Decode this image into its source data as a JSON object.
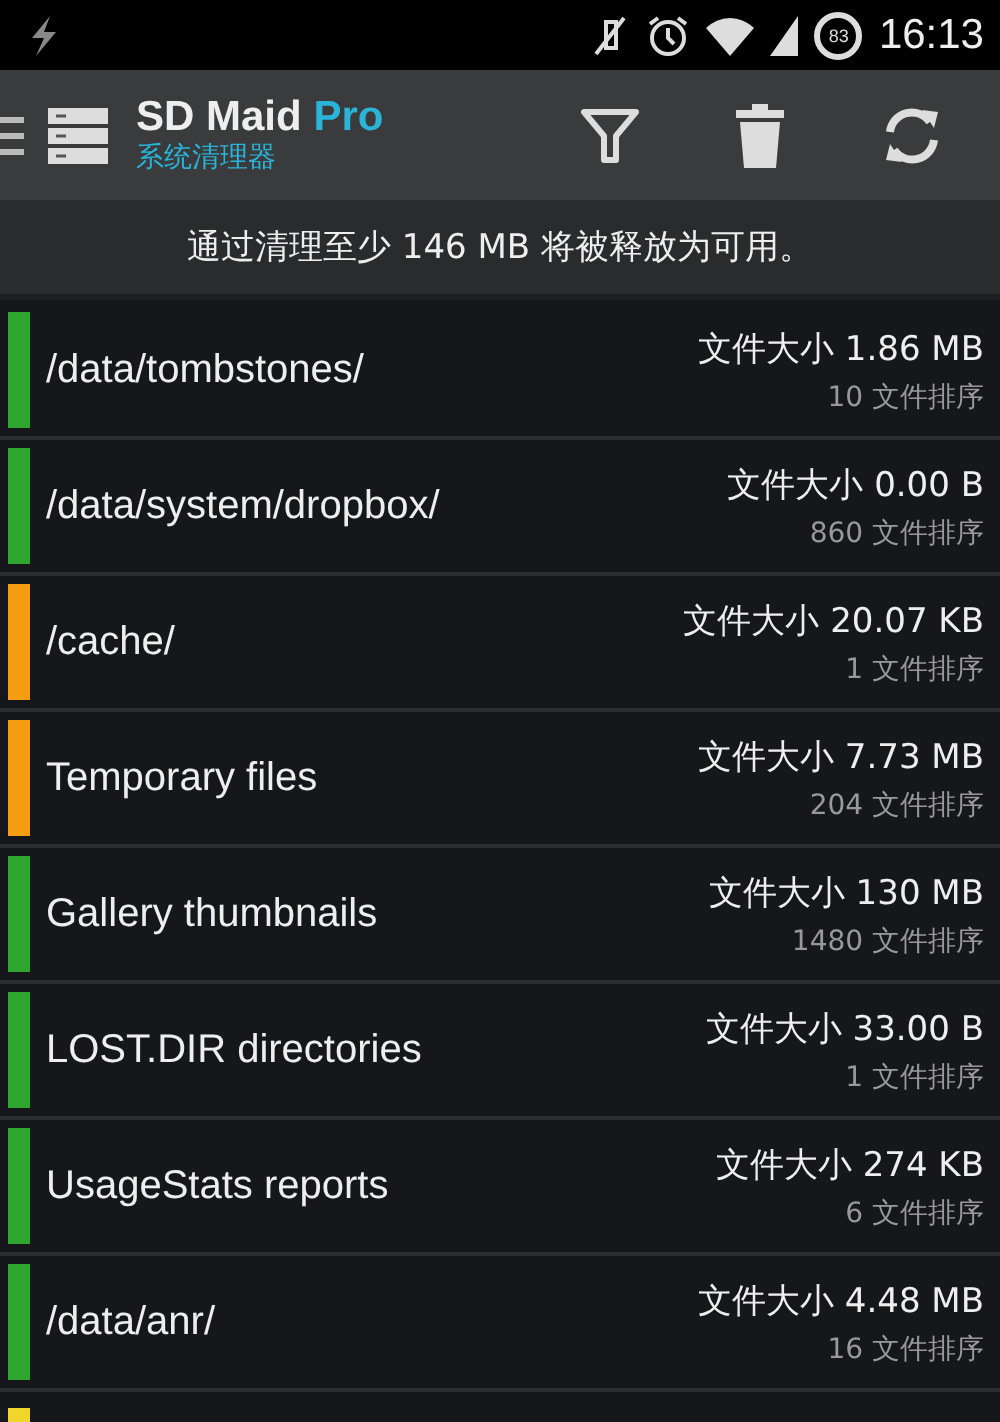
{
  "status_bar": {
    "battery": "83",
    "time": "16:13"
  },
  "toolbar": {
    "title": "SD Maid",
    "title_accent": "Pro",
    "subtitle": "系统清理器"
  },
  "banner": "通过清理至少 146 MB 将被释放为可用。",
  "rows": [
    {
      "name": "/data/tombstones/",
      "size": "文件大小 1.86 MB",
      "count": "10 文件排序",
      "color": "#2ea52e"
    },
    {
      "name": "/data/system/dropbox/",
      "size": "文件大小 0.00 B",
      "count": "860 文件排序",
      "color": "#2ea52e"
    },
    {
      "name": "/cache/",
      "size": "文件大小 20.07 KB",
      "count": "1 文件排序",
      "color": "#f59c10"
    },
    {
      "name": "Temporary files",
      "size": "文件大小 7.73 MB",
      "count": "204 文件排序",
      "color": "#f59c10"
    },
    {
      "name": "Gallery thumbnails",
      "size": "文件大小 130 MB",
      "count": "1480 文件排序",
      "color": "#2ea52e"
    },
    {
      "name": "LOST.DIR directories",
      "size": "文件大小 33.00 B",
      "count": "1 文件排序",
      "color": "#2ea52e"
    },
    {
      "name": "UsageStats reports",
      "size": "文件大小 274 KB",
      "count": "6 文件排序",
      "color": "#2ea52e"
    },
    {
      "name": "/data/anr/",
      "size": "文件大小 4.48 MB",
      "count": "16 文件排序",
      "color": "#2ea52e"
    }
  ],
  "partial_row": {
    "color": "#f2d52a"
  }
}
